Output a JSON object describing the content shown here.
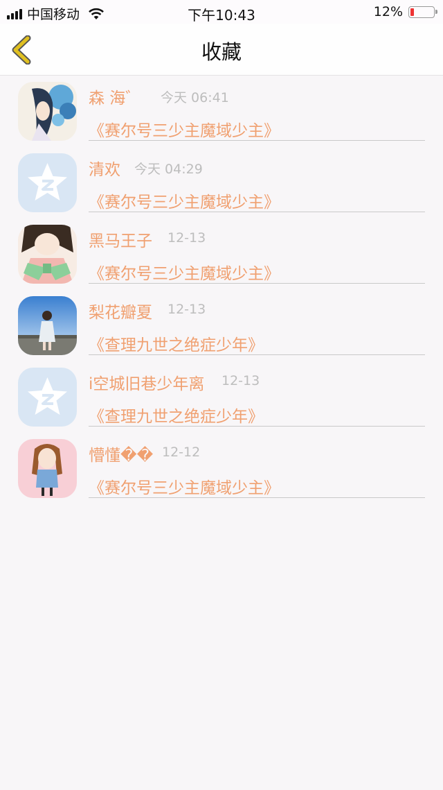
{
  "status_bar": {
    "carrier": "中国移动",
    "time": "下午10:43",
    "battery": "12%"
  },
  "header": {
    "title": "收藏"
  },
  "favorites": [
    {
      "name": "森 海゛",
      "time": "今天 06:41",
      "title": "《赛尔号三少主魔域少主》",
      "avatar": "anime-girl-blue-flowers"
    },
    {
      "name": "清欢",
      "time": "今天 04:29",
      "title": "《赛尔号三少主魔域少主》",
      "avatar": "qzone-star-default"
    },
    {
      "name": "黑马王子",
      "time": "12-13",
      "title": "《赛尔号三少主魔域少主》",
      "avatar": "anime-girl-green-scarf"
    },
    {
      "name": "梨花瓣夏",
      "time": "12-13",
      "title": "《查理九世之绝症少年》",
      "avatar": "girl-blue-sky-photo"
    },
    {
      "name": "i空城旧巷少年离",
      "time": "12-13",
      "title": "《查理九世之绝症少年》",
      "avatar": "qzone-star-default"
    },
    {
      "name": "懵懂��",
      "time": "12-12",
      "title": "《赛尔号三少主魔域少主》",
      "avatar": "cartoon-girl-pink"
    }
  ],
  "colors": {
    "accent": "#f0a070",
    "back_arrow": "#e0c020"
  }
}
